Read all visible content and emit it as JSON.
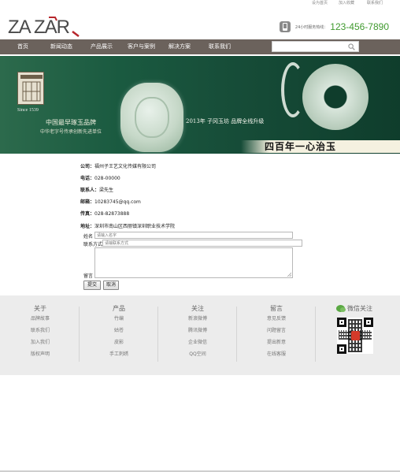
{
  "topbar": {
    "links": [
      "设为首页",
      "加入收藏",
      "联系我们"
    ]
  },
  "header": {
    "logo_text": "ZA ZAR",
    "phone_label": "24小时服务热线：",
    "phone_number": "123-456-7890"
  },
  "nav": {
    "items": [
      {
        "label": "首页"
      },
      {
        "label": "新闻动态"
      },
      {
        "label": "产品展示"
      },
      {
        "label": "客户与案例"
      },
      {
        "label": "解决方案"
      },
      {
        "label": "联系我们"
      }
    ],
    "search_placeholder": ""
  },
  "banner": {
    "since": "Since 1539",
    "tagline1": "中国最早琢玉品牌",
    "tagline2": "中华老字号传承创新先进单位",
    "brand_line": "2013年 子冈玉坊 品牌全线升级",
    "slogan": "四百年一心治玉"
  },
  "contact": {
    "company_label": "公司：",
    "company_value": "福州子王艺文化传媒有限公司",
    "phone_label": "电话：",
    "phone_value": "028-00000",
    "person_label": "联系人：",
    "person_value": "梁先生",
    "email_label": "邮箱：",
    "email_value": "10283745@qq.com",
    "fax_label": "传真：",
    "fax_value": "028-82873888",
    "address_label": "地址：",
    "address_value": "深圳市南山区西丽镇深圳职业技术学院"
  },
  "form": {
    "name_label": "姓名",
    "name_placeholder": "请输入名字",
    "contact_label": "联系方式",
    "contact_placeholder": "请输联系方式",
    "message_label": "留言",
    "submit_label": "提交",
    "cancel_label": "取消"
  },
  "footer": {
    "columns": [
      {
        "title": "关于",
        "links": [
          "品牌故事",
          "联系我们",
          "加入我们",
          "版权声明"
        ]
      },
      {
        "title": "产品",
        "links": [
          "竹编",
          "姑苍",
          "皮影",
          "手工刺绣"
        ]
      },
      {
        "title": "关注",
        "links": [
          "新浪微博",
          "腾讯微博",
          "企业微信",
          "QQ空间"
        ]
      },
      {
        "title": "留言",
        "links": [
          "意见反馈",
          "问题留言",
          "提出新意",
          "在线客服"
        ]
      }
    ],
    "wechat_title": "微信关注"
  },
  "colors": {
    "nav_bg": "#6b625c",
    "phone_green": "#3f9a2e",
    "banner_green": "#174e39",
    "footer_bg": "#ececec"
  }
}
